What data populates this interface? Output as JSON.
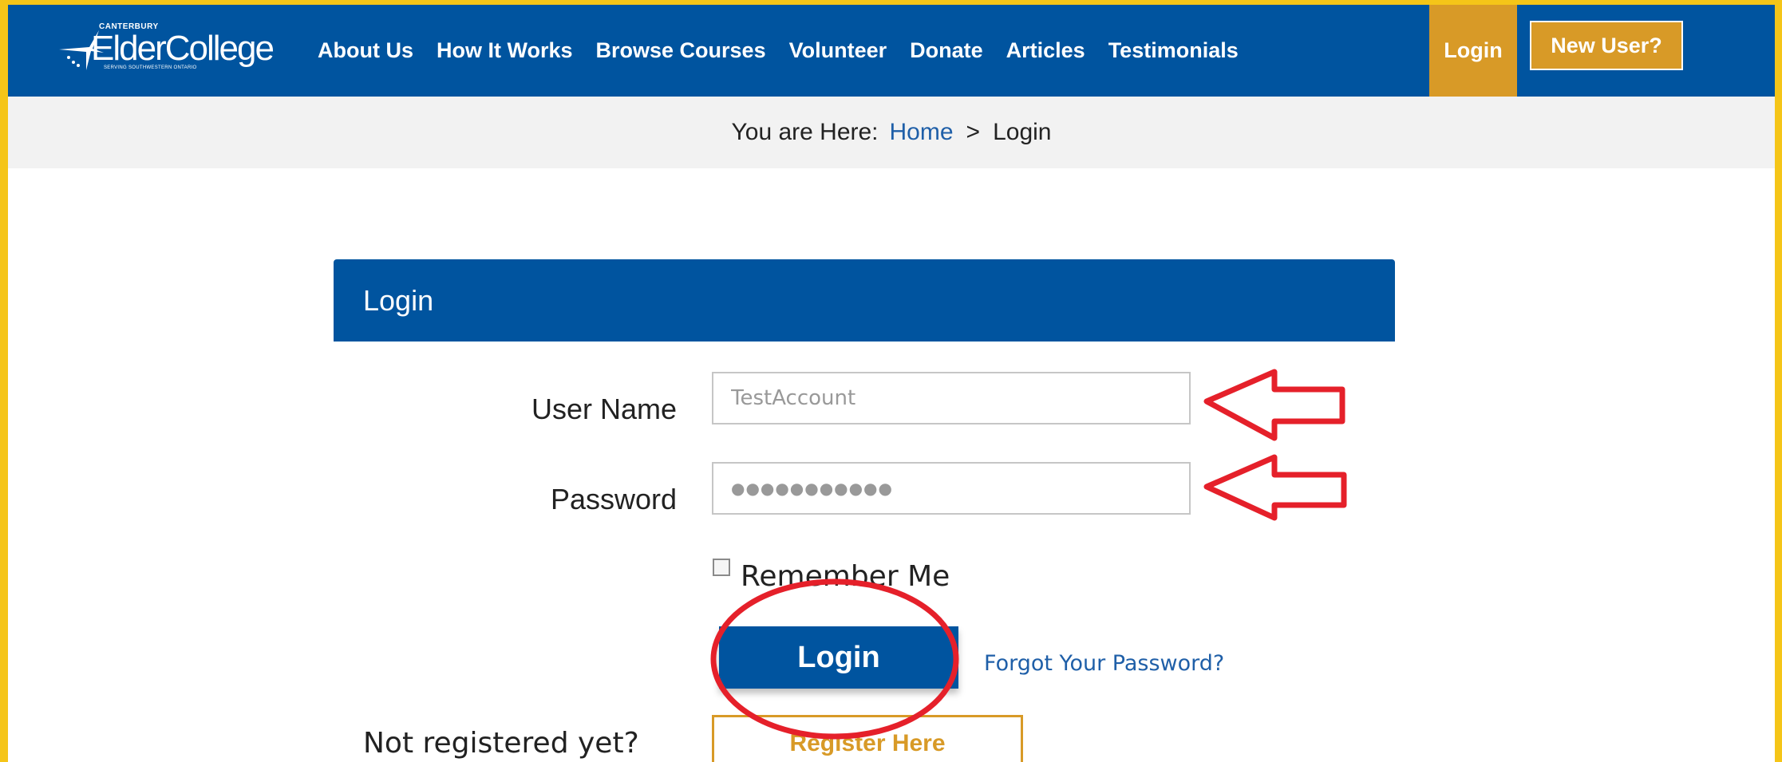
{
  "logo": {
    "top_text": "CANTERBURY",
    "main_text": "ElderCollege",
    "sub_text": "SERVING SOUTHWESTERN ONTARIO"
  },
  "nav": {
    "items": [
      {
        "label": "About Us"
      },
      {
        "label": "How It Works"
      },
      {
        "label": "Browse Courses"
      },
      {
        "label": "Volunteer"
      },
      {
        "label": "Donate"
      },
      {
        "label": "Articles"
      },
      {
        "label": "Testimonials"
      }
    ],
    "login_label": "Login",
    "new_user_label": "New User?"
  },
  "breadcrumb": {
    "prefix": "You are Here:",
    "home": "Home",
    "separator": ">",
    "current": "Login"
  },
  "login_form": {
    "title": "Login",
    "username_label": "User Name",
    "username_value": "TestAccount",
    "password_label": "Password",
    "password_mask": "●●●●●●●●●●●",
    "remember_label": "Remember Me",
    "remember_checked": false,
    "submit_label": "Login",
    "forgot_label": "Forgot Your Password?",
    "not_registered_label": "Not registered yet?",
    "register_label": "Register Here"
  },
  "colors": {
    "brand_blue": "#00549f",
    "accent_gold": "#d89a27",
    "frame_yellow": "#f5c518",
    "annotation_red": "#e5202a"
  },
  "annotations": {
    "arrows": [
      "username-arrow",
      "password-arrow"
    ],
    "circle": "login-button-circle"
  }
}
